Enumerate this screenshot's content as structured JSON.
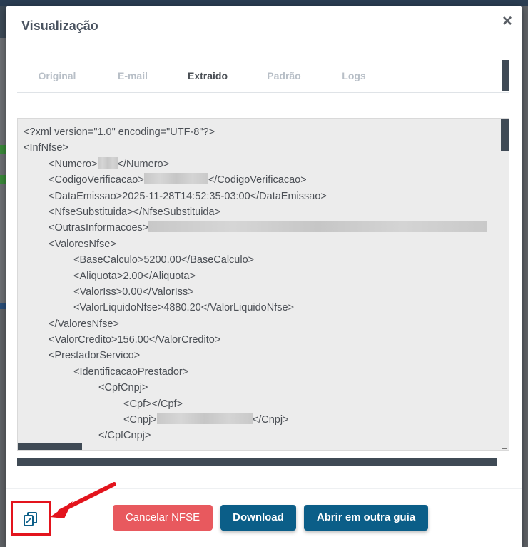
{
  "modal": {
    "title": "Visualização",
    "close_label": "×"
  },
  "tabs": [
    {
      "label": "Original",
      "active": false
    },
    {
      "label": "E-mail",
      "active": false
    },
    {
      "label": "Extraido",
      "active": true
    },
    {
      "label": "Padrão",
      "active": false
    },
    {
      "label": "Logs",
      "active": false
    }
  ],
  "xml": {
    "lines": [
      {
        "text": "<?xml version=\"1.0\" encoding=\"UTF-8\"?>"
      },
      {
        "text": "<InfNfse>"
      },
      {
        "open": "<Numero>",
        "close": "</Numero>",
        "redacted": true
      },
      {
        "open": "<CodigoVerificacao>",
        "close": "</CodigoVerificacao>",
        "redacted": true
      },
      {
        "text": "<DataEmissao>2025-11-28T14:52:35-03:00</DataEmissao>"
      },
      {
        "text": "<NfseSubstituida></NfseSubstituida>"
      },
      {
        "open": "<OutrasInformacoes>",
        "close": "",
        "redacted": true
      },
      {
        "text": "<ValoresNfse>"
      },
      {
        "text": "<BaseCalculo>5200.00</BaseCalculo>"
      },
      {
        "text": "<Aliquota>2.00</Aliquota>"
      },
      {
        "text": "<ValorIss>0.00</ValorIss>"
      },
      {
        "text": "<ValorLiquidoNfse>4880.20</ValorLiquidoNfse>"
      },
      {
        "text": "</ValoresNfse>"
      },
      {
        "text": "<ValorCredito>156.00</ValorCredito>"
      },
      {
        "text": "<PrestadorServico>"
      },
      {
        "text": "<IdentificacaoPrestador>"
      },
      {
        "text": "<CpfCnpj>"
      },
      {
        "text": "<Cpf></Cpf>"
      },
      {
        "open": "<Cnpj>",
        "close": "</Cnpj>",
        "redacted": true
      },
      {
        "text": "</CpfCnpj>"
      }
    ]
  },
  "footer": {
    "copy_icon": "copy-icon",
    "cancel_label": "Cancelar NFSE",
    "download_label": "Download",
    "open_tab_label": "Abrir em outra guia"
  },
  "colors": {
    "primary": "#0b5e88",
    "danger": "#e8595e",
    "highlight": "#e3141d"
  }
}
